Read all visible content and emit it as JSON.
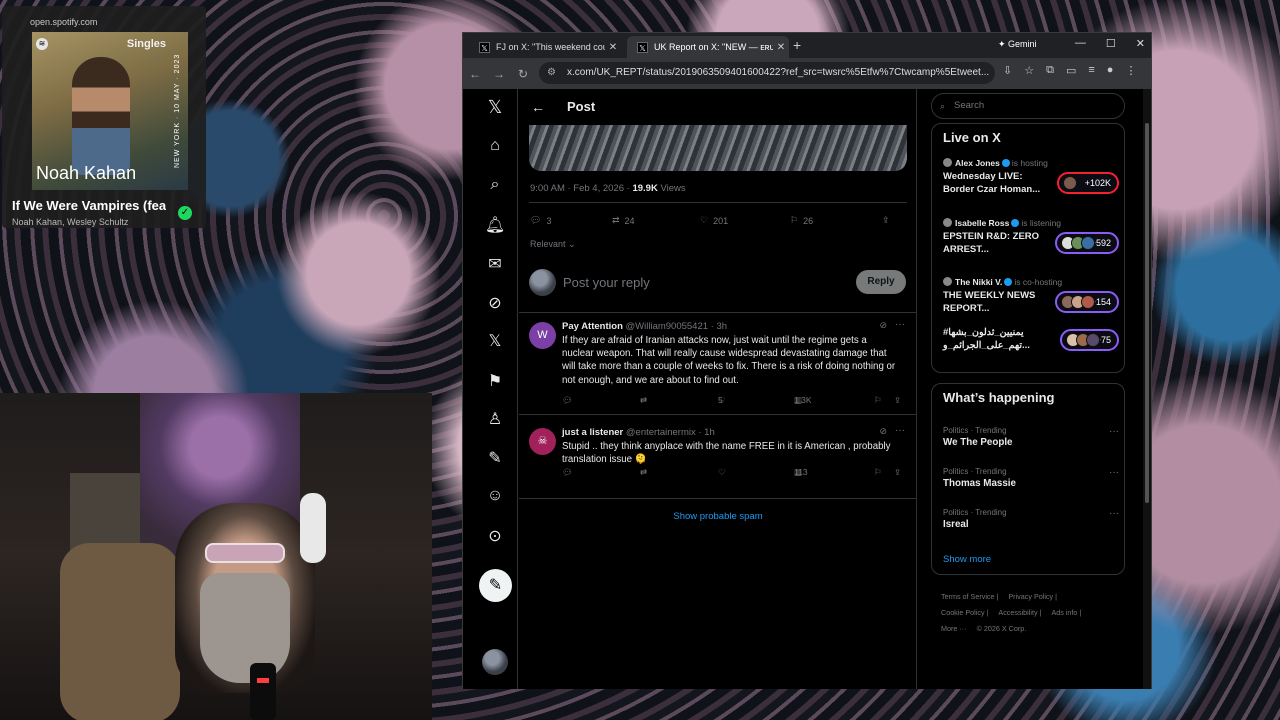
{
  "spotify": {
    "url": "open.spotify.com",
    "badge": "Singles",
    "cover_artist": "Noah Kahan",
    "cover_vertical": "NEW YORK · 10 MAY · 2023",
    "track_title": "If We Were Vampires (feat.",
    "artists": "Noah Kahan, Wesley Schultz"
  },
  "browser": {
    "tabs": [
      {
        "label": "FJ on X: \"This weekend could pro",
        "icon": "x-logo-icon"
      },
      {
        "label": "UK Report on X: \"NEW — ᴇʀᴜs ᴛ",
        "icon": "x-logo-icon"
      }
    ],
    "gemini_label": "Gemini",
    "url": "x.com/UK_REPT/status/2019063509401600422?ref_src=twsrc%5Etfw%7Ctwcamp%5Etweet..."
  },
  "x": {
    "header_title": "Post",
    "post_meta": {
      "time": "9:00 AM · Feb 4, 2026 · ",
      "views_count": "19.9K",
      "views_label": " Views"
    },
    "post_stats": {
      "replies": "3",
      "reposts": "24",
      "likes": "201",
      "bookmarks": "26"
    },
    "sort_label": "Relevant",
    "reply_placeholder": "Post your reply",
    "reply_button": "Reply",
    "replies": [
      {
        "avatar_letter": "W",
        "avatar_color": "#7b3fa6",
        "name": "Pay Attention",
        "handle": "@William90055421 · 3h",
        "text": "If they are afraid of Iranian attacks now, just wait until the regime gets a nuclear weapon. That will really cause widespread devastating damage that will take more than a couple of weeks to fix. There is a risk of doing nothing or not enough, and we are about to find out.",
        "likes": "5",
        "views": "1.3K"
      },
      {
        "avatar_letter": "☠",
        "avatar_color": "#a1215b",
        "name": "just a listener",
        "handle": "@entertainermix · 1h",
        "text": "Stupid .. they think anyplace with the name FREE in it is American , probably translation issue 🫠",
        "likes": "",
        "views": "113"
      }
    ],
    "show_spam": "Show probable spam",
    "search_placeholder": "Search",
    "live": {
      "heading": "Live on X",
      "items": [
        {
          "host": "Alex Jones",
          "status": "is hosting",
          "title": "Wednesday LIVE: Border Czar Homan...",
          "count": "+102K"
        },
        {
          "host": "Isabelle Ross",
          "status": "is listening",
          "title": "EPSTEIN R&D: ZERO ARREST...",
          "count": "+592"
        },
        {
          "host": "The Nikki V.",
          "status": "is co-hosting",
          "title": "THE WEEKLY NEWS REPORT...",
          "count": "+154"
        },
        {
          "host": "",
          "status": "",
          "title": "#يمنيين_ثدلون_بشها تهم_على_الجرائم_و...",
          "count": "+75"
        }
      ]
    },
    "happening": {
      "heading": "What’s happening",
      "trends": [
        {
          "category": "Politics · Trending",
          "name": "We The People"
        },
        {
          "category": "Politics · Trending",
          "name": "Thomas Massie"
        },
        {
          "category": "Politics · Trending",
          "name": "Isreal"
        }
      ],
      "show_more": "Show more"
    },
    "footer": {
      "links": [
        "Terms of Service |",
        "Privacy Policy |",
        "Cookie Policy |",
        "Accessibility |",
        "Ads info |",
        "More ···",
        "© 2026 X Corp."
      ]
    }
  },
  "colors": {
    "x_blue": "#1d9bf0",
    "live_purple": "#8b5cf6",
    "live_red": "#f4212e",
    "spotify_green": "#1ed760"
  }
}
